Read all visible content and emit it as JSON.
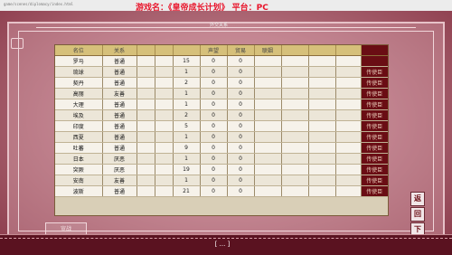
{
  "window": {
    "path": "game/scenes/diplomacy/index.html",
    "watermark": "游戏名：《皇帝成长计划》  平台：PC",
    "subtitle": "外交关系"
  },
  "table": {
    "columns": [
      "名位",
      "关系",
      "",
      "",
      "",
      "声望",
      "贸易",
      "联姻",
      "",
      "",
      "",
      ""
    ],
    "rows": [
      {
        "name": "罗马",
        "relation": "普通",
        "prestige": "15",
        "trade": "0",
        "marriage": "0",
        "action": ""
      },
      {
        "name": "琉球",
        "relation": "普通",
        "prestige": "1",
        "trade": "0",
        "marriage": "0",
        "action": "传使臣"
      },
      {
        "name": "契丹",
        "relation": "普通",
        "prestige": "2",
        "trade": "0",
        "marriage": "0",
        "action": "传使臣"
      },
      {
        "name": "高丽",
        "relation": "友善",
        "prestige": "1",
        "trade": "0",
        "marriage": "0",
        "action": "传使臣"
      },
      {
        "name": "大理",
        "relation": "普通",
        "prestige": "1",
        "trade": "0",
        "marriage": "0",
        "action": "传使臣"
      },
      {
        "name": "埃及",
        "relation": "普通",
        "prestige": "2",
        "trade": "0",
        "marriage": "0",
        "action": "传使臣"
      },
      {
        "name": "印度",
        "relation": "普通",
        "prestige": "5",
        "trade": "0",
        "marriage": "0",
        "action": "传使臣"
      },
      {
        "name": "西夏",
        "relation": "普通",
        "prestige": "1",
        "trade": "0",
        "marriage": "0",
        "action": "传使臣"
      },
      {
        "name": "吐蕃",
        "relation": "普通",
        "prestige": "9",
        "trade": "0",
        "marriage": "0",
        "action": "传使臣"
      },
      {
        "name": "日本",
        "relation": "厌恶",
        "prestige": "1",
        "trade": "0",
        "marriage": "0",
        "action": "传使臣"
      },
      {
        "name": "突厥",
        "relation": "厌恶",
        "prestige": "19",
        "trade": "0",
        "marriage": "0",
        "action": "传使臣"
      },
      {
        "name": "安南",
        "relation": "友善",
        "prestige": "1",
        "trade": "0",
        "marriage": "0",
        "action": "传使臣"
      },
      {
        "name": "波斯",
        "relation": "普通",
        "prestige": "21",
        "trade": "0",
        "marriage": "0",
        "action": "传使臣"
      }
    ]
  },
  "buttons": {
    "left": "宣战",
    "side": [
      "返",
      "回",
      "下"
    ]
  },
  "footer": {
    "page": "[ ... ]"
  },
  "colors": {
    "accent": "#6a0d14",
    "header": "#d6c07a",
    "watermark": "#e8142a"
  }
}
